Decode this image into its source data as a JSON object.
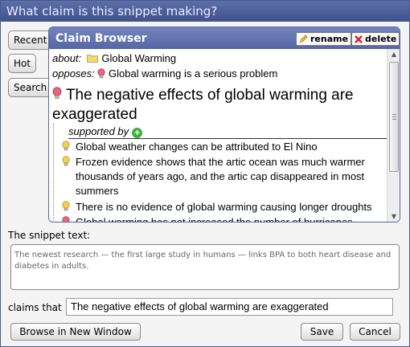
{
  "dialog": {
    "title": "What claim is this snippet making?"
  },
  "side_tabs": [
    "Recent",
    "Hot",
    "Search"
  ],
  "browser": {
    "title": "Claim Browser",
    "rename_label": "rename",
    "delete_label": "delete",
    "about_label": "about:",
    "about_value": "Global Warming",
    "opposes_label": "opposes:",
    "opposes_value": "Global warming is a serious problem",
    "main_claim": "The negative effects of global warming are exaggerated",
    "supported_by_label": "supported by",
    "supporting_claims": [
      {
        "text": "Global weather changes can be attributed to El Nino",
        "icon": "yellow-bulb-icon"
      },
      {
        "text": "Frozen evidence shows that the artic ocean was much warmer thousands of years ago, and the artic cap disappeared in most summers",
        "icon": "yellow-bulb-icon"
      },
      {
        "text": "There is no evidence of global warming causing longer droughts",
        "icon": "yellow-bulb-icon"
      },
      {
        "text": "Global warming has not increased the number of hurricanes",
        "icon": "red-bulb-icon"
      }
    ]
  },
  "snippet": {
    "label": "The snippet text:",
    "text": "The newest research — the first large study in humans — links BPA to both heart disease and diabetes in adults."
  },
  "claims_that": {
    "label": "claims that",
    "value": "The negative effects of global warming are exaggerated"
  },
  "buttons": {
    "browse": "Browse in New Window",
    "save": "Save",
    "cancel": "Cancel"
  },
  "colors": {
    "title_bar": "#40528c",
    "browser_header": "#5566a4",
    "bulb_yellow": "#f3d34a",
    "bulb_red": "#e8667a",
    "plus_green": "#3fae3f"
  }
}
